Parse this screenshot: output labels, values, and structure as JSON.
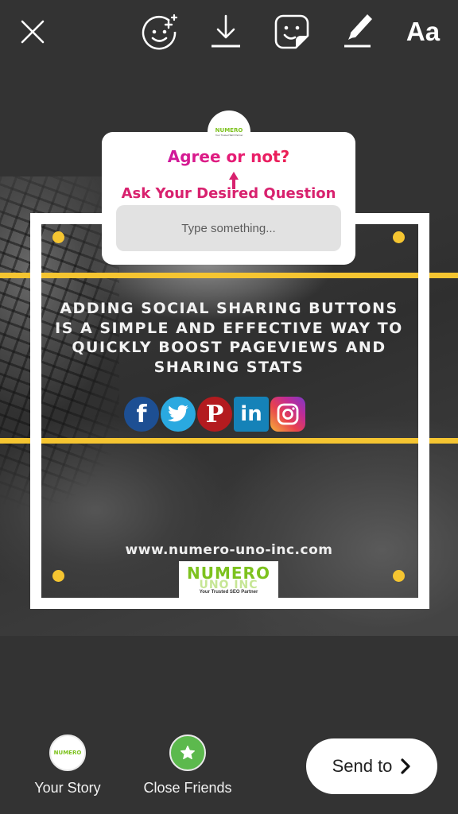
{
  "toolbar": {
    "close": {
      "icon": "close-icon"
    },
    "effects": {
      "icon": "face-effects-icon"
    },
    "download": {
      "icon": "download-icon"
    },
    "sticker": {
      "icon": "sticker-icon"
    },
    "draw": {
      "icon": "draw-icon"
    },
    "text": {
      "icon": "text-icon",
      "label": "Aa"
    }
  },
  "story": {
    "headline": "Adding social sharing buttons is a simple and effective way to quickly boost pageviews and sharing stats",
    "social_icons": [
      {
        "name": "facebook",
        "glyph": "f",
        "color": "#1d4f93"
      },
      {
        "name": "twitter",
        "glyph": "",
        "color": "#2aa9e0"
      },
      {
        "name": "pinterest",
        "glyph": "P",
        "color": "#b31b1f"
      },
      {
        "name": "linkedin",
        "glyph": "in",
        "color": "#1582b8"
      },
      {
        "name": "instagram",
        "glyph": "",
        "color": "#c02c96"
      }
    ],
    "website": "www.numero-uno-inc.com",
    "logo": {
      "word": "NUMERO",
      "word2": "UNO INC",
      "tagline": "Your Trusted SEO Partner"
    },
    "accent_color": "#f5c531"
  },
  "question_sticker": {
    "avatar_logo": "NUMERO",
    "avatar_tagline": "Your Trusted SEO Partner",
    "question": "Agree or not?",
    "hint": "Ask Your Desired Question",
    "input_placeholder": "Type something...",
    "input_value": ""
  },
  "bottom": {
    "your_story": {
      "label": "Your Story",
      "avatar_logo": "NUMERO"
    },
    "close_friends": {
      "label": "Close Friends",
      "icon": "star-icon",
      "color": "#5cb94d"
    },
    "send": {
      "label": "Send to",
      "icon": "chevron-right-icon"
    }
  }
}
